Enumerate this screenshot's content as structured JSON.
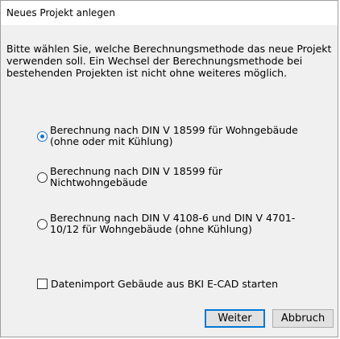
{
  "window": {
    "title": "Neues Projekt anlegen"
  },
  "intro_text": "Bitte wählen Sie, welche Berechnungsmethode das neue Projekt verwenden soll. Ein Wechsel der Berechnungsmethode bei bestehenden Projekten ist nicht ohne weiteres möglich.",
  "options": [
    {
      "label": "Berechnung nach DIN V 18599 für Wohngebäude (ohne oder mit Kühlung)",
      "selected": true
    },
    {
      "label": "Berechnung nach DIN V 18599 für Nichtwohngebäude",
      "selected": false
    },
    {
      "label": "Berechnung nach DIN V 4108-6 und DIN V 4701-10/12 für Wohngebäude (ohne Kühlung)",
      "selected": false
    }
  ],
  "import_checkbox": {
    "label": "Datenimport Gebäude aus BKI E-CAD starten",
    "checked": false
  },
  "buttons": {
    "next": "Weiter",
    "cancel": "Abbruch"
  },
  "colors": {
    "accent": "#0078d7",
    "radio_dot": "#1a73d1"
  }
}
